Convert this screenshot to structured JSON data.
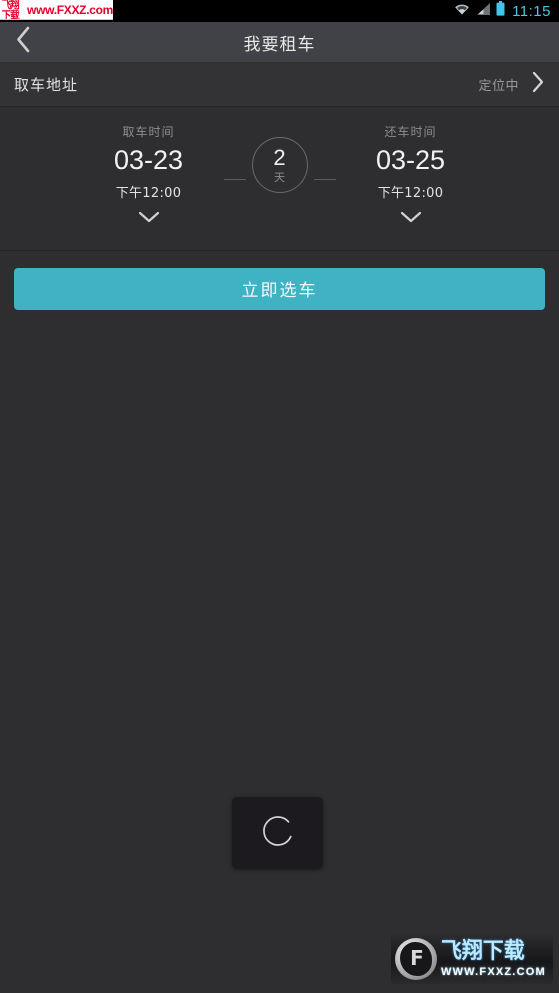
{
  "status_bar": {
    "time": "11:15",
    "icons": [
      "wifi-icon",
      "signal-icon",
      "battery-icon"
    ],
    "clock_color": "#49c7e0"
  },
  "watermark_top": {
    "cn_text": "飞翔下载",
    "url_text": "www.FXXZ.com",
    "color": "#e4002b"
  },
  "title_bar": {
    "back_icon": "chevron-left-icon",
    "title": "我要租车",
    "background": "#414247"
  },
  "address_row": {
    "label": "取车地址",
    "status": "定位中",
    "chevron_icon": "chevron-right-icon"
  },
  "date_picker": {
    "pickup": {
      "caption": "取车时间",
      "date": "03-23",
      "time": "下午12:00",
      "chevron_icon": "chevron-down-icon"
    },
    "duration": {
      "value": "2",
      "unit": "天"
    },
    "dropoff": {
      "caption": "还车时间",
      "date": "03-25",
      "time": "下午12:00",
      "chevron_icon": "chevron-down-icon"
    }
  },
  "cta": {
    "label": "立即选车",
    "color": "#3fb2c3"
  },
  "loading": {
    "icon": "spinner-icon"
  },
  "watermark_bottom": {
    "logo_icon": "fxxz-logo-icon",
    "mark": "F",
    "cn_text": "飞翔下载",
    "url_text": "WWW.FXXZ.COM"
  }
}
